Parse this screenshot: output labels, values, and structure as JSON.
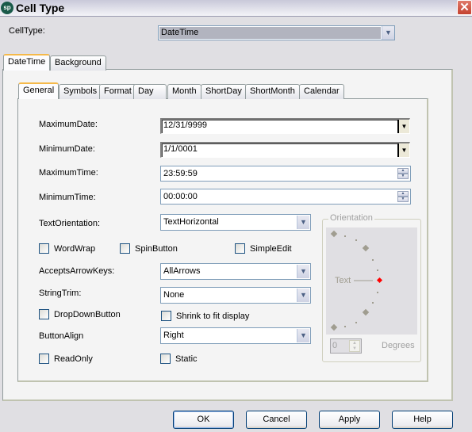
{
  "window": {
    "title": "Cell Type",
    "app_icon": "sp",
    "close_icon": "close-icon"
  },
  "celltype": {
    "label": "CellType:",
    "value": "DateTime"
  },
  "outer_tabs": [
    {
      "label": "DateTime",
      "active": true
    },
    {
      "label": "Background",
      "active": false
    }
  ],
  "inner_tabs": [
    {
      "label": "General",
      "active": true
    },
    {
      "label": "Symbols",
      "active": false
    },
    {
      "label": "Format",
      "active": false
    },
    {
      "label": "Day",
      "active": false
    },
    {
      "label": "Month",
      "active": false
    },
    {
      "label": "ShortDay",
      "active": false
    },
    {
      "label": "ShortMonth",
      "active": false
    },
    {
      "label": "Calendar",
      "active": false
    }
  ],
  "general": {
    "maximum_date": {
      "label": "MaximumDate:",
      "value": "12/31/9999"
    },
    "minimum_date": {
      "label": "MinimumDate:",
      "value": "1/1/0001"
    },
    "maximum_time": {
      "label": "MaximumTime:",
      "value": "23:59:59"
    },
    "minimum_time": {
      "label": "MinimumTime:",
      "value": "00:00:00"
    },
    "text_orientation": {
      "label": "TextOrientation:",
      "value": "TextHorizontal"
    },
    "word_wrap": {
      "label": "WordWrap",
      "checked": false
    },
    "spin_button": {
      "label": "SpinButton",
      "checked": false
    },
    "simple_edit": {
      "label": "SimpleEdit",
      "checked": false
    },
    "accepts_arrow_keys": {
      "label": "AcceptsArrowKeys:",
      "value": "AllArrows"
    },
    "string_trim": {
      "label": "StringTrim:",
      "value": "None"
    },
    "drop_down_button": {
      "label": "DropDownButton",
      "checked": false
    },
    "shrink_to_fit": {
      "label": "Shrink to fit display",
      "checked": false
    },
    "button_align": {
      "label": "ButtonAlign",
      "value": "Right"
    },
    "read_only": {
      "label": "ReadOnly",
      "checked": false
    },
    "static": {
      "label": "Static",
      "checked": false
    }
  },
  "orientation": {
    "legend": "Orientation",
    "dial_text": "Text",
    "degrees_value": "0",
    "degrees_label": "Degrees",
    "selected_color": "#ff0000"
  },
  "buttons": {
    "ok": "OK",
    "cancel": "Cancel",
    "apply": "Apply",
    "help": "Help"
  }
}
